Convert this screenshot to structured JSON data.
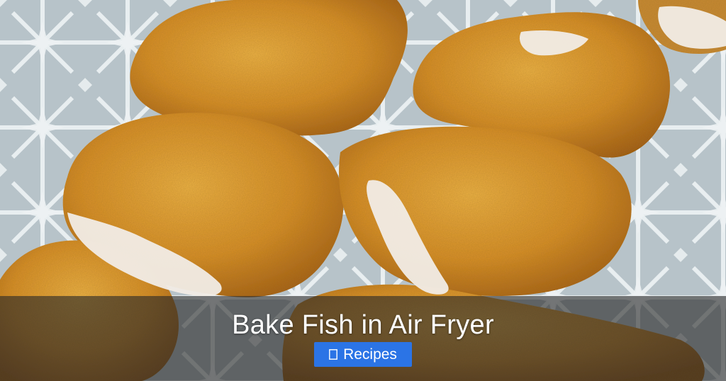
{
  "page": {
    "title": "Bake Fish in Air Fryer"
  },
  "badge": {
    "label": "Recipes",
    "icon": "folder-icon",
    "color": "#2b74e6"
  },
  "colors": {
    "plate": "#b9c4c9",
    "pattern": "#e7eef0",
    "crust": "#d6922a",
    "crust_dark": "#a95f12",
    "fish_flesh": "#f2ede7",
    "overlay": "rgba(40,40,40,0.62)"
  }
}
